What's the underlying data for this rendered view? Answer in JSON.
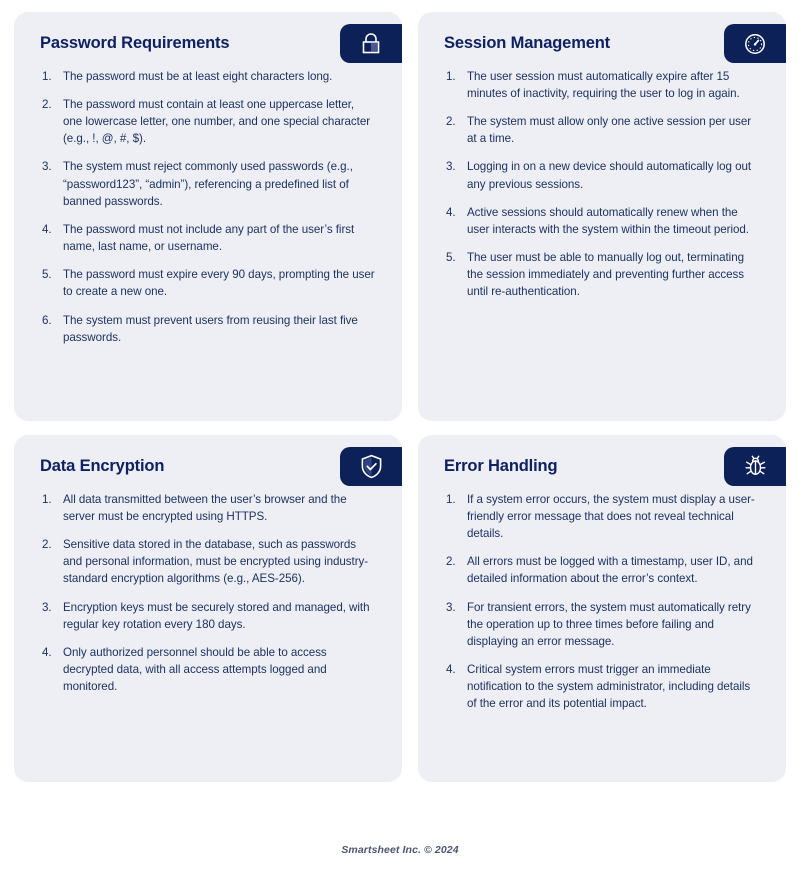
{
  "colors": {
    "page_background": "#ffffff",
    "card_background": "#edeff4",
    "badge_navy": "#0d2159",
    "title_navy": "#0f2161",
    "body_text": "#1e3262",
    "footer_text": "#4c566f"
  },
  "cards": [
    {
      "title": "Password Requirements",
      "icon": "lock-icon",
      "items": [
        "The password must be at least eight characters long.",
        "The password must contain at least one uppercase letter, one lowercase letter, one number, and one special character (e.g., !, @, #, $).",
        "The system must reject commonly used passwords (e.g., “password123”, “admin”), referencing a predefined list of banned passwords.",
        "The password must not include any part of the user’s first name, last name, or username.",
        "The password must expire every 90 days, prompting the user to create a new one.",
        "The system must prevent users from reusing their last five passwords."
      ]
    },
    {
      "title": "Session Management",
      "icon": "timer-gauge-icon",
      "items": [
        "The user session must automatically expire after 15 minutes of inactivity, requiring the user to log in again.",
        "The system must allow only one active session per user at a time.",
        "Logging in on a new device should automatically log out any previous sessions.",
        "Active sessions should automatically renew when the user interacts with the system within the timeout period.",
        "The user must be able to manually log out, terminating the session immediately and preventing further access until re-authentication."
      ]
    },
    {
      "title": "Data Encryption",
      "icon": "shield-check-icon",
      "items": [
        "All data transmitted between the user’s browser and the server must be encrypted using HTTPS.",
        "Sensitive data stored in the database, such as passwords and personal information, must be encrypted using industry-standard encryption algorithms (e.g., AES-256).",
        "Encryption keys must be securely stored and managed, with regular key rotation every 180 days.",
        "Only authorized personnel should be able to access decrypted data, with all access attempts logged and monitored."
      ]
    },
    {
      "title": "Error Handling",
      "icon": "bug-icon",
      "items": [
        "If a system error occurs, the system must display a user-friendly error message that does not reveal technical details.",
        "All errors must be logged with a timestamp, user ID, and detailed information about the error’s context.",
        "For transient errors, the system must automatically retry the operation up to three times before failing and displaying an error message.",
        "Critical system errors must trigger an immediate notification to the system administrator, including details of the error and its potential impact."
      ]
    }
  ],
  "footer": {
    "text": "Smartsheet Inc. © 2024"
  }
}
